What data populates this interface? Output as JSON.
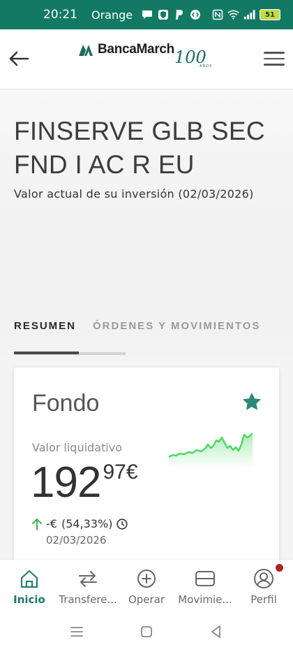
{
  "status_bar": {
    "time": "20:21",
    "carrier": "Orange",
    "battery": "51",
    "icons": [
      "chat-icon",
      "shield-icon",
      "paypal-icon",
      "shazam-icon",
      "nfc-icon",
      "wifi-icon",
      "signal-icon"
    ]
  },
  "header": {
    "brand": "BancaMarch",
    "anniversary": "100",
    "anniversary_sub": "AÑOS"
  },
  "fund": {
    "name": "FINSERVE GLB SEC FND I AC R EU",
    "subtitle": "Valor actual de su inversión (02/03/2026)"
  },
  "tabs": [
    {
      "label": "RESUMEN",
      "active": true
    },
    {
      "label": "ÓRDENES Y MOVIMIENTOS",
      "active": false
    }
  ],
  "card": {
    "title": "Fondo",
    "value_label": "Valor liquidativo",
    "price_int": "192",
    "price_dec": "97",
    "currency": "€",
    "change_amount": "-€",
    "change_percent": "(54,33%)",
    "change_date": "02/03/2026",
    "favorited": true
  },
  "bottom_nav": [
    {
      "label": "Inicio",
      "icon": "home-icon",
      "active": true
    },
    {
      "label": "Transfere...",
      "icon": "transfer-icon",
      "active": false
    },
    {
      "label": "Operar",
      "icon": "plus-circle-icon",
      "active": false
    },
    {
      "label": "Movimie...",
      "icon": "wallet-icon",
      "active": false
    },
    {
      "label": "Perfil",
      "icon": "user-icon",
      "active": false,
      "badge": true
    }
  ],
  "colors": {
    "brand_green": "#127a64",
    "accent_green": "#1a7a66",
    "chart_green": "#4cd964",
    "star_teal": "#2a8a78",
    "badge_red": "#b52025"
  }
}
